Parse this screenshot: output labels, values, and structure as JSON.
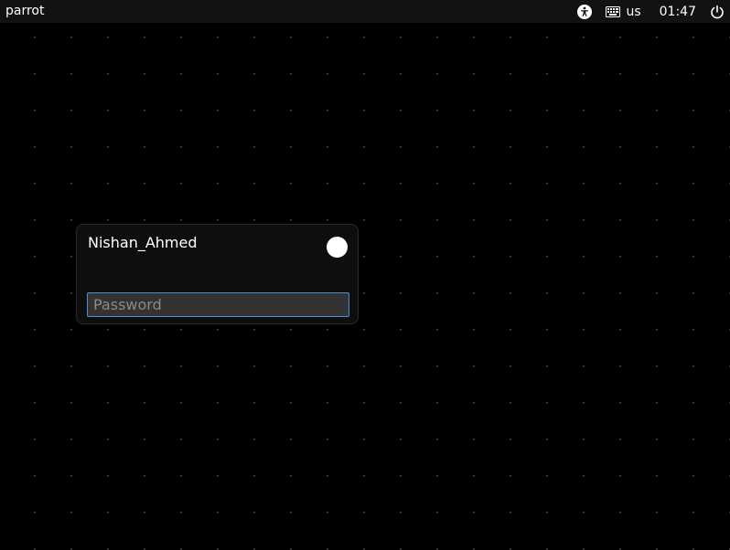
{
  "topbar": {
    "hostname": "parrot",
    "accessibility_icon": "accessibility-icon",
    "keyboard_icon": "keyboard-icon",
    "keyboard_layout": "us",
    "clock": "01:47",
    "power_icon": "power-icon"
  },
  "login": {
    "username": "Nishan_Ahmed",
    "session_button_icon": "session-dot-icon",
    "password_value": "",
    "password_placeholder": "Password"
  },
  "colors": {
    "background": "#000000",
    "topbar": "#121212",
    "panel": "#0e0e0e",
    "input_bg": "#333333",
    "focus_border": "#4a90d9",
    "text": "#ffffff"
  }
}
